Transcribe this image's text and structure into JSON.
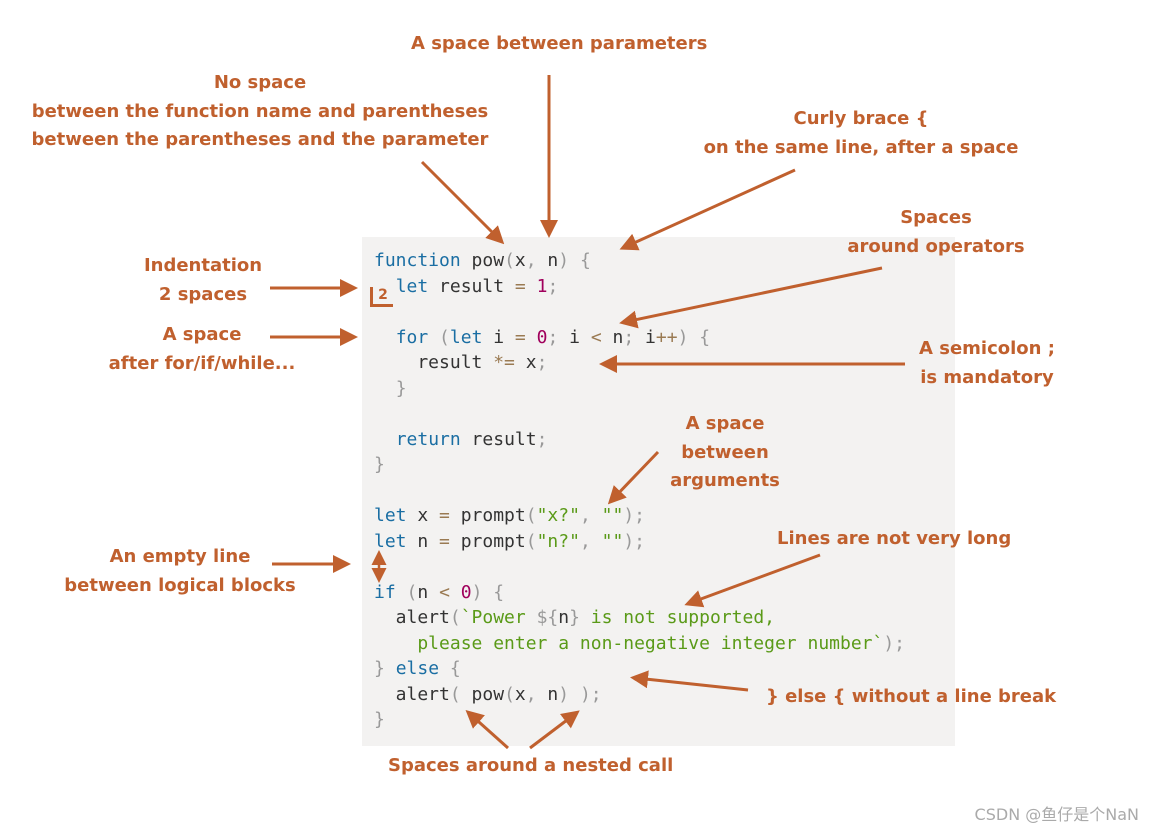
{
  "annotations": {
    "params_space": "A space between parameters",
    "no_space_title": "No space",
    "no_space_line1": "between the function name and parentheses",
    "no_space_line2": "between the parentheses and the parameter",
    "curly_line1": "Curly brace {",
    "curly_line2": "on the same line, after a space",
    "ops_line1": "Spaces",
    "ops_line2": "around operators",
    "indent_line1": "Indentation",
    "indent_line2": "2 spaces",
    "for_line1": "A space",
    "for_line2": "after for/if/while...",
    "semi_line1": "A semicolon ;",
    "semi_line2": "is mandatory",
    "args_line1": "A space",
    "args_line2": "between",
    "args_line3": "arguments",
    "empty_line1": "An empty line",
    "empty_line2": "between logical blocks",
    "long_lines": "Lines are not very long",
    "else_label": "} else { without a line break",
    "nested_call": "Spaces around a nested call"
  },
  "indent_badge": "2",
  "code_lines": [
    "function pow(x, n) {",
    "  let result = 1;",
    "",
    "  for (let i = 0; i < n; i++) {",
    "    result *= x;",
    "  }",
    "",
    "  return result;",
    "}",
    "",
    "let x = prompt(\"x?\", \"\");",
    "let n = prompt(\"n?\", \"\");",
    "",
    "if (n < 0) {",
    "  alert(`Power ${n} is not supported,",
    "    please enter a non-negative integer number`);",
    "} else {",
    "  alert( pow(x, n) );",
    "}"
  ],
  "watermark": "CSDN @鱼仔是个NaN",
  "colors": {
    "accent": "#c0602e",
    "keyword": "#1a6ea3",
    "number": "#a0005c",
    "string": "#5a9a18",
    "background": "#f3f2f1"
  }
}
